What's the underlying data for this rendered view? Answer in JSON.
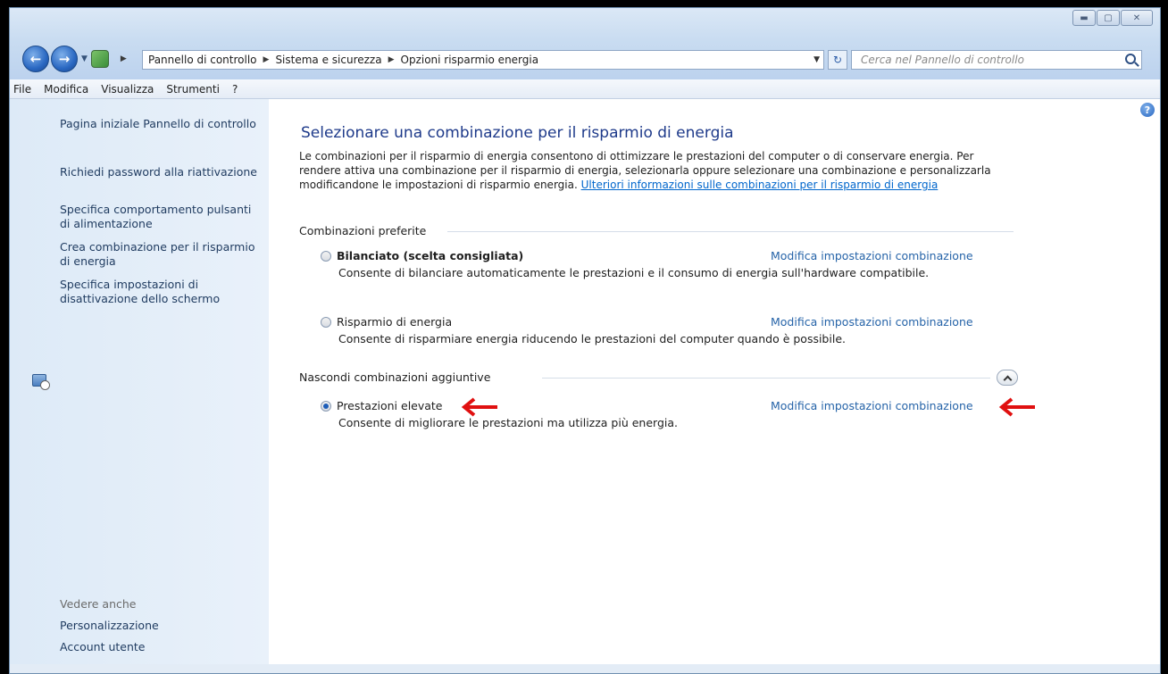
{
  "breadcrumb": [
    "Pannello di controllo",
    "Sistema e sicurezza",
    "Opzioni risparmio energia"
  ],
  "search": {
    "placeholder": "Cerca nel Pannello di controllo"
  },
  "menu": [
    "File",
    "Modifica",
    "Visualizza",
    "Strumenti",
    "?"
  ],
  "sidebar": {
    "links": [
      "Pagina iniziale Pannello di controllo",
      "Richiedi password alla riattivazione",
      "Specifica comportamento pulsanti di alimentazione",
      "Crea combinazione per il risparmio di energia",
      "Specifica impostazioni di disattivazione dello schermo"
    ],
    "see_also_title": "Vedere anche",
    "see_also": [
      "Personalizzazione",
      "Account utente"
    ]
  },
  "main": {
    "title": "Selezionare una combinazione per il risparmio di energia",
    "intro": "Le combinazioni per il risparmio di energia consentono di ottimizzare le prestazioni del computer o di conservare energia. Per rendere attiva una combinazione per il risparmio di energia, selezionarla oppure selezionare una combinazione e personalizzarla modificandone le impostazioni di risparmio energia.",
    "intro_link": "Ulteriori informazioni sulle combinazioni per il risparmio di energia",
    "preferred_header": "Combinazioni preferite",
    "hidden_header": "Nascondi combinazioni aggiuntive",
    "plans": [
      {
        "name": "Bilanciato (scelta consigliata)",
        "desc": "Consente di bilanciare automaticamente le prestazioni e il consumo di energia sull'hardware compatibile.",
        "link": "Modifica impostazioni combinazione",
        "selected": false
      },
      {
        "name": "Risparmio di energia",
        "desc": "Consente di risparmiare energia riducendo le prestazioni del computer quando è possibile.",
        "link": "Modifica impostazioni combinazione",
        "selected": false
      },
      {
        "name": "Prestazioni elevate",
        "desc": "Consente di migliorare le prestazioni ma utilizza più energia.",
        "link": "Modifica impostazioni combinazione",
        "selected": true
      }
    ]
  },
  "colors": {
    "link": "#2563a8",
    "title": "#1e3a8a",
    "arrow": "#e01010"
  }
}
